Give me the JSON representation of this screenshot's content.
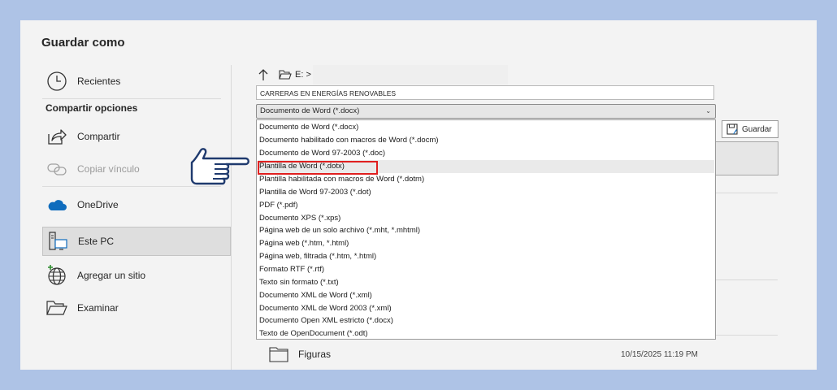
{
  "window": {
    "title": "Guardar como"
  },
  "sidebar": {
    "items": [
      {
        "label": "Recientes",
        "icon": "clock-icon"
      },
      {
        "label": "Compartir",
        "icon": "share-icon"
      },
      {
        "label": "Copiar vínculo",
        "icon": "link-icon",
        "disabled": true
      },
      {
        "label": "OneDrive",
        "icon": "onedrive-cloud-icon"
      },
      {
        "label": "Este PC",
        "icon": "computer-icon",
        "selected": true
      },
      {
        "label": "Agregar un sitio",
        "icon": "globe-add-icon"
      },
      {
        "label": "Examinar",
        "icon": "folder-open-icon"
      }
    ],
    "section_heading": "Compartir opciones"
  },
  "location": {
    "path": "E: >"
  },
  "filename": {
    "value": "CARRERAS EN ENERGÍAS RENOVABLES"
  },
  "filetype": {
    "selected": "Documento de Word (*.docx)",
    "options": [
      "Documento de Word (*.docx)",
      "Documento habilitado con macros de Word (*.docm)",
      "Documento de Word 97-2003 (*.doc)",
      "Plantilla de Word (*.dotx)",
      "Plantilla habilitada con macros de Word (*.dotm)",
      "Plantilla de Word 97-2003 (*.dot)",
      "PDF (*.pdf)",
      "Documento XPS (*.xps)",
      "Página web de un solo archivo (*.mht, *.mhtml)",
      "Página web (*.htm, *.html)",
      "Página web, filtrada (*.htm, *.html)",
      "Formato RTF (*.rtf)",
      "Texto sin formato (*.txt)",
      "Documento XML de Word (*.xml)",
      "Documento XML de Word 2003 (*.xml)",
      "Documento Open XML estricto (*.docx)",
      "Texto de OpenDocument (*.odt)"
    ],
    "highlighted_option": "Plantilla de Word (*.dotx)"
  },
  "toolbar": {
    "save_label": "Guardar"
  },
  "files": [
    {
      "name": "Figuras",
      "modified": "10/15/2025 11:19 PM"
    }
  ],
  "colors": {
    "background": "#aec3e6",
    "highlight_border": "#e02020",
    "onedrive": "#0f6cbd"
  }
}
